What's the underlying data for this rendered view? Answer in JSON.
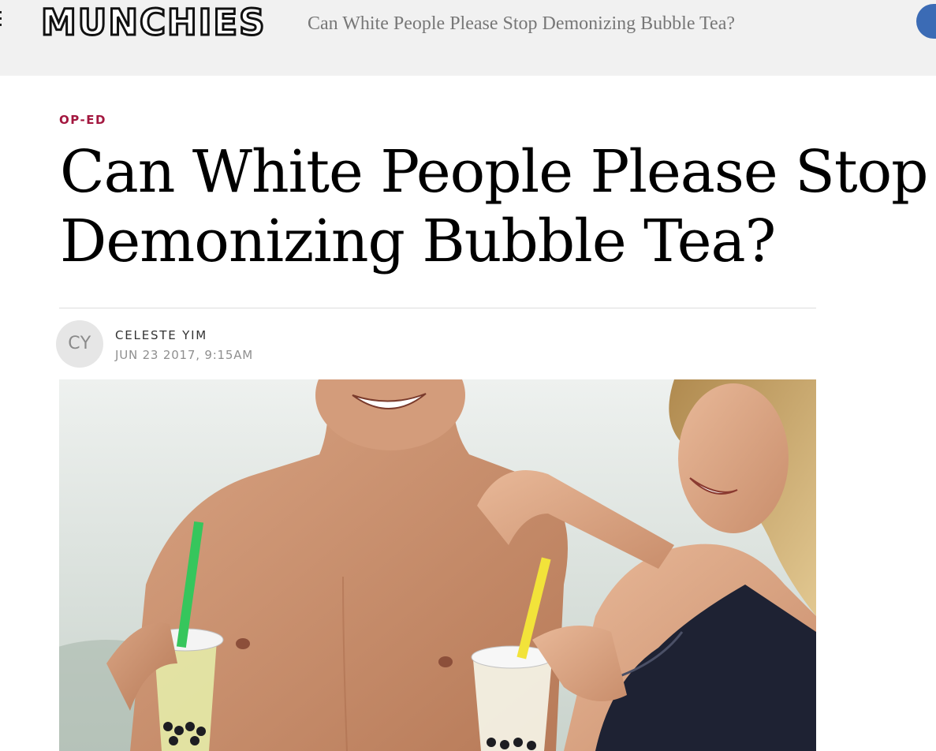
{
  "header": {
    "logo": "MUNCHIES",
    "nav_title": "Can White People Please Stop Demonizing Bubble Tea?"
  },
  "article": {
    "category": "OP-ED",
    "headline_lines": [
      "Can White People Please Stop",
      "Demonizing Bubble Tea?"
    ],
    "author": {
      "initials": "CY",
      "name": "CELESTE YIM"
    },
    "timestamp": "JUN 23 2017, 9:15AM",
    "hero_image": {
      "description_icon": "photo-icon"
    }
  },
  "colors": {
    "category": "#a3173f",
    "topbar_bg": "#f1f1f1",
    "user_button": "#3b6bb5"
  }
}
